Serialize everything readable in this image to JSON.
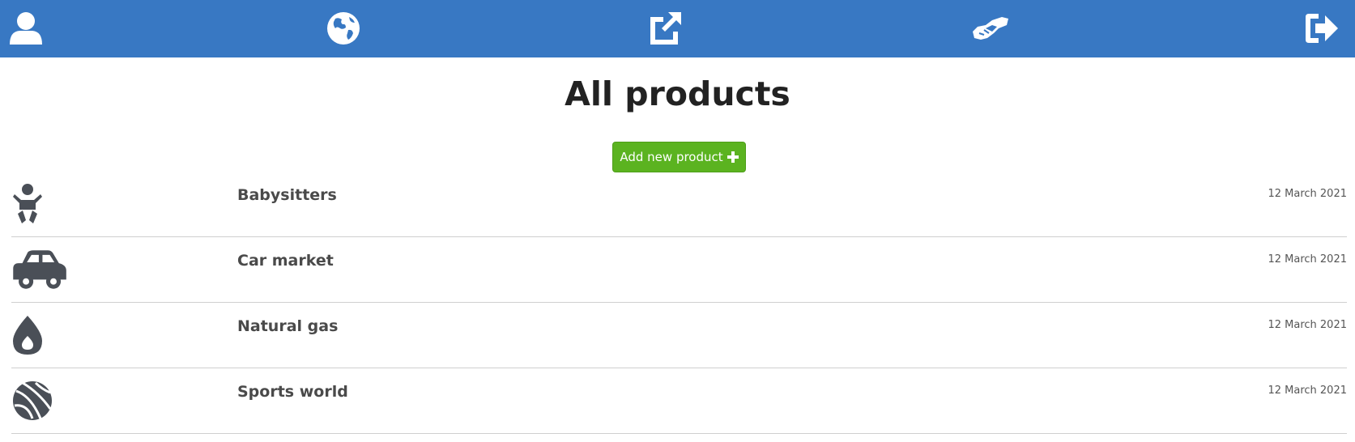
{
  "nav": {
    "items": [
      {
        "icon": "user-icon"
      },
      {
        "icon": "globe-icon"
      },
      {
        "icon": "external-link-icon"
      },
      {
        "icon": "handshake-icon"
      },
      {
        "icon": "sign-out-icon"
      }
    ],
    "background_color": "#3878c3"
  },
  "main": {
    "title": "All products",
    "add_button_label": "Add new product",
    "add_button_icon": "plus-icon",
    "add_button_color": "#5bb320"
  },
  "products": [
    {
      "icon": "baby-icon",
      "name": "Babysitters",
      "date": "12 March 2021"
    },
    {
      "icon": "car-icon",
      "name": "Car market",
      "date": "12 March 2021"
    },
    {
      "icon": "droplet-icon",
      "name": "Natural gas",
      "date": "12 March 2021"
    },
    {
      "icon": "basketball-icon",
      "name": "Sports world",
      "date": "12 March 2021"
    }
  ]
}
